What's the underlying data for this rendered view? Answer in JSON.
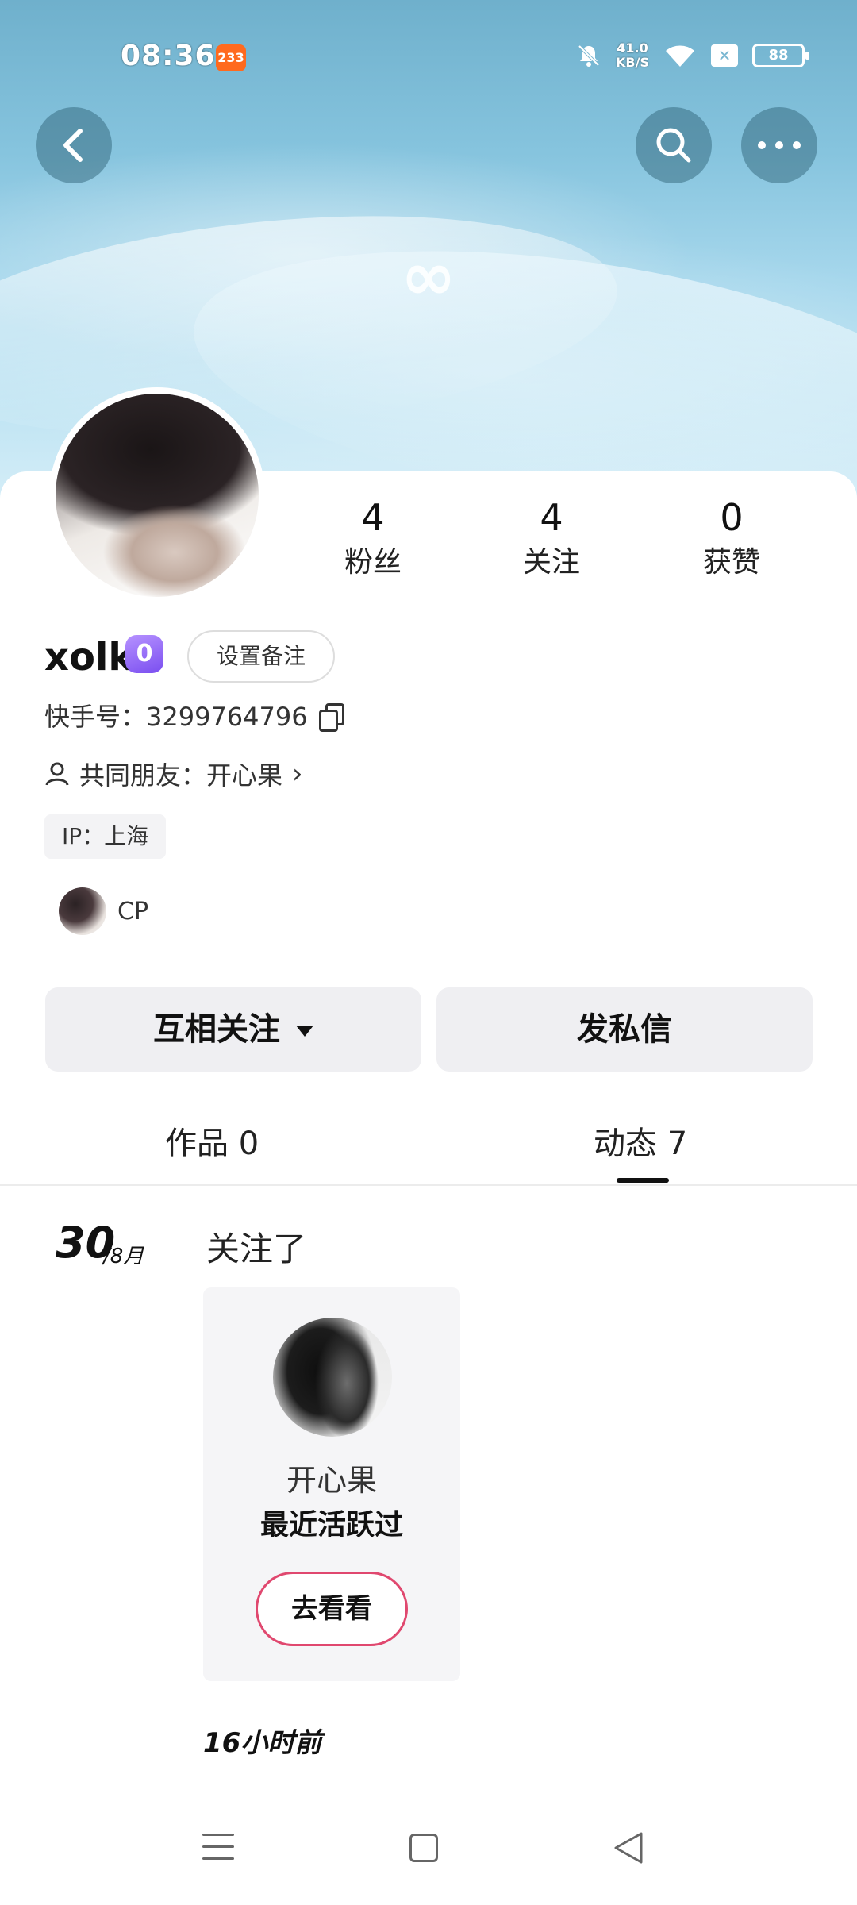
{
  "status_bar": {
    "time": "08:36",
    "notification_badge": "233",
    "net_speed_value": "41.0",
    "net_speed_unit": "KB/S",
    "battery": "88",
    "icons": [
      "mute-bell-icon",
      "wifi-icon",
      "sim-x-icon",
      "battery-icon"
    ]
  },
  "header": {
    "back_icon": "back-chevron-icon",
    "search_icon": "search-icon",
    "more_icon": "more-dots-icon",
    "banner_symbol": "∞"
  },
  "stats": [
    {
      "value": "4",
      "label": "粉丝"
    },
    {
      "value": "4",
      "label": "关注"
    },
    {
      "value": "0",
      "label": "获赞"
    }
  ],
  "profile": {
    "name": "xolk",
    "badge_text": "0",
    "remark_button": "设置备注",
    "kuaishou_id": "快手号：3299764796",
    "mutual_friends": "共同朋友：开心果",
    "ip_location": "IP：上海",
    "cp_label": "CP"
  },
  "actions": {
    "follow_state": "互相关注",
    "message": "发私信"
  },
  "tabs": [
    {
      "label": "作品 0",
      "active": false
    },
    {
      "label": "动态 7",
      "active": true
    }
  ],
  "feed": {
    "day": "30",
    "month": "/8月",
    "action": "关注了",
    "card": {
      "name": "开心果",
      "status": "最近活跃过",
      "button": "去看看"
    },
    "time": "16小时前"
  },
  "colors": {
    "accent_pink": "#e0486f",
    "badge_purple": "#8f63f4",
    "notification_orange": "#ff6a1e"
  }
}
